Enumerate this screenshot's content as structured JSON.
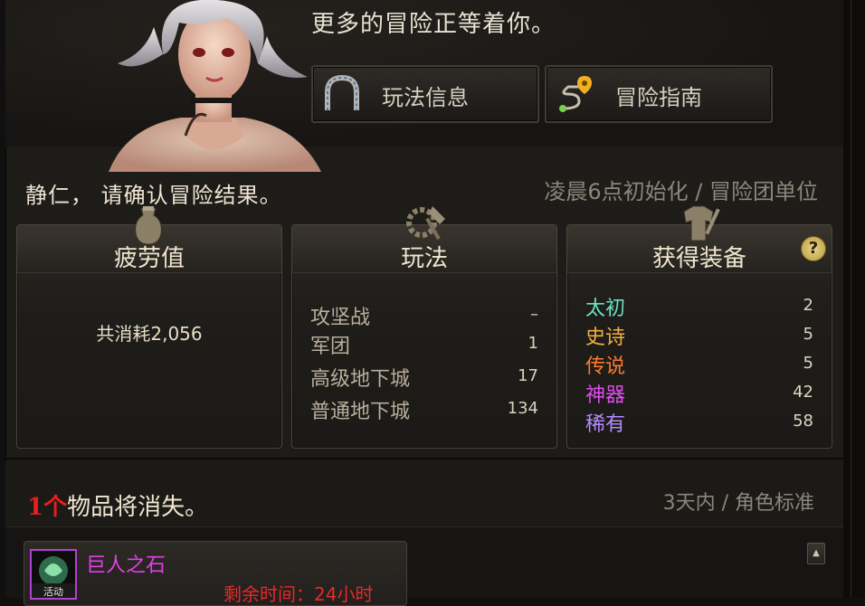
{
  "header": {
    "tagline": "更多的冒险正等着你。",
    "buttons": [
      {
        "label": "玩法信息",
        "icon": "arch-gate-icon"
      },
      {
        "label": "冒险指南",
        "icon": "map-route-icon"
      }
    ]
  },
  "summary": {
    "greeting": "静仁， 请确认冒险结果。",
    "reset_note": "凌晨6点初始化 / 冒险团单位"
  },
  "fatigue": {
    "title": "疲劳值",
    "text": "共消耗2,056"
  },
  "modes": {
    "title": "玩法",
    "rows": [
      {
        "name": "攻坚战",
        "value": "–"
      },
      {
        "name": "军团",
        "value": "1"
      },
      {
        "name": "高级地下城",
        "value": "17"
      },
      {
        "name": "普通地下城",
        "value": "134"
      }
    ]
  },
  "equipment": {
    "title": "获得装备",
    "help": "?",
    "rows": [
      {
        "name": "太初",
        "value": "2",
        "color": "#6de0c0"
      },
      {
        "name": "史诗",
        "value": "5",
        "color": "#f0b040"
      },
      {
        "name": "传说",
        "value": "5",
        "color": "#ff7a2e"
      },
      {
        "name": "神器",
        "value": "42",
        "color": "#e04cf0"
      },
      {
        "name": "稀有",
        "value": "58",
        "color": "#b48cff"
      }
    ]
  },
  "expiring": {
    "count": "1个",
    "text": "物品将消失。",
    "note": "3天内 / 角色标准",
    "items": [
      {
        "name": "巨人之石",
        "time_left": "剩余时间：24小时",
        "tag": "活动"
      }
    ]
  }
}
